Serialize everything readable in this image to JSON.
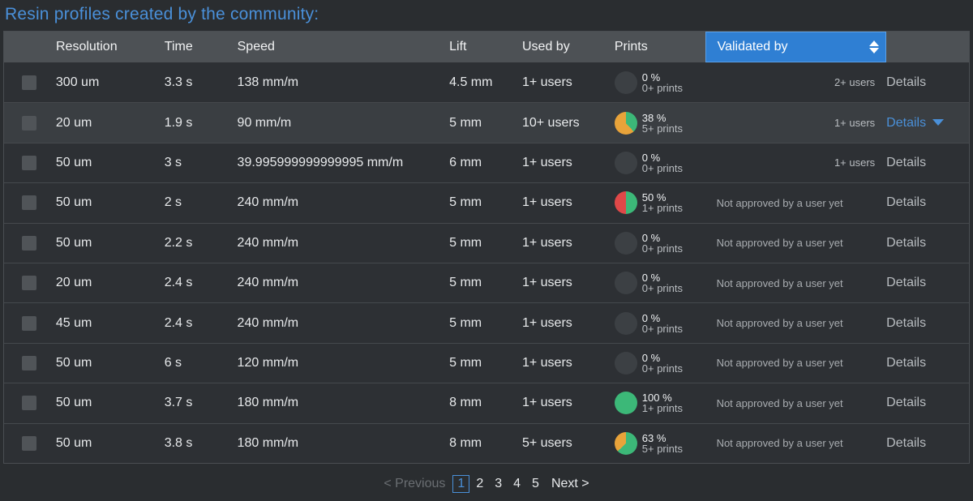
{
  "title": "Resin profiles created by the community:",
  "columns": {
    "resolution": "Resolution",
    "time": "Time",
    "speed": "Speed",
    "lift": "Lift",
    "used_by": "Used by",
    "prints": "Prints",
    "validated_by": "Validated by"
  },
  "rows": [
    {
      "resolution": "300 um",
      "time": "3.3 s",
      "speed": "138 mm/m",
      "lift": "4.5 mm",
      "used_by": "1+ users",
      "prints_pct": "0 %",
      "prints_count": "0+ prints",
      "pie_fraction": 0,
      "pie_color": "#e8a33a",
      "validated": "2+ users",
      "validated_type": "users",
      "details": "Details",
      "details_active": false
    },
    {
      "resolution": "20 um",
      "time": "1.9 s",
      "speed": "90 mm/m",
      "lift": "5 mm",
      "used_by": "10+ users",
      "prints_pct": "38 %",
      "prints_count": "5+ prints",
      "pie_fraction": 0.38,
      "pie_color": "#e8a33a",
      "validated": "1+ users",
      "validated_type": "users",
      "details": "Details",
      "details_active": true
    },
    {
      "resolution": "50 um",
      "time": "3 s",
      "speed": "39.995999999999995 mm/m",
      "lift": "6 mm",
      "used_by": "1+ users",
      "prints_pct": "0 %",
      "prints_count": "0+ prints",
      "pie_fraction": 0,
      "pie_color": "#e8a33a",
      "validated": "1+ users",
      "validated_type": "users",
      "details": "Details",
      "details_active": false
    },
    {
      "resolution": "50 um",
      "time": "2 s",
      "speed": "240 mm/m",
      "lift": "5 mm",
      "used_by": "1+ users",
      "prints_pct": "50 %",
      "prints_count": "1+ prints",
      "pie_fraction": 0.5,
      "pie_color": "#e04848",
      "validated": "Not approved by a user yet",
      "validated_type": "none",
      "details": "Details",
      "details_active": false
    },
    {
      "resolution": "50 um",
      "time": "2.2 s",
      "speed": "240 mm/m",
      "lift": "5 mm",
      "used_by": "1+ users",
      "prints_pct": "0 %",
      "prints_count": "0+ prints",
      "pie_fraction": 0,
      "pie_color": "#e8a33a",
      "validated": "Not approved by a user yet",
      "validated_type": "none",
      "details": "Details",
      "details_active": false
    },
    {
      "resolution": "20 um",
      "time": "2.4 s",
      "speed": "240 mm/m",
      "lift": "5 mm",
      "used_by": "1+ users",
      "prints_pct": "0 %",
      "prints_count": "0+ prints",
      "pie_fraction": 0,
      "pie_color": "#e8a33a",
      "validated": "Not approved by a user yet",
      "validated_type": "none",
      "details": "Details",
      "details_active": false
    },
    {
      "resolution": "45 um",
      "time": "2.4 s",
      "speed": "240 mm/m",
      "lift": "5 mm",
      "used_by": "1+ users",
      "prints_pct": "0 %",
      "prints_count": "0+ prints",
      "pie_fraction": 0,
      "pie_color": "#e8a33a",
      "validated": "Not approved by a user yet",
      "validated_type": "none",
      "details": "Details",
      "details_active": false
    },
    {
      "resolution": "50 um",
      "time": "6 s",
      "speed": "120 mm/m",
      "lift": "5 mm",
      "used_by": "1+ users",
      "prints_pct": "0 %",
      "prints_count": "0+ prints",
      "pie_fraction": 0,
      "pie_color": "#e8a33a",
      "validated": "Not approved by a user yet",
      "validated_type": "none",
      "details": "Details",
      "details_active": false
    },
    {
      "resolution": "50 um",
      "time": "3.7 s",
      "speed": "180 mm/m",
      "lift": "8 mm",
      "used_by": "1+ users",
      "prints_pct": "100 %",
      "prints_count": "1+ prints",
      "pie_fraction": 1,
      "pie_color": "#e8a33a",
      "validated": "Not approved by a user yet",
      "validated_type": "none",
      "details": "Details",
      "details_active": false
    },
    {
      "resolution": "50 um",
      "time": "3.8 s",
      "speed": "180 mm/m",
      "lift": "8 mm",
      "used_by": "5+ users",
      "prints_pct": "63 %",
      "prints_count": "5+ prints",
      "pie_fraction": 0.63,
      "pie_color": "#e8a33a",
      "validated": "Not approved by a user yet",
      "validated_type": "none",
      "details": "Details",
      "details_active": false
    }
  ],
  "colors": {
    "pie_success": "#3cb878",
    "pie_empty": "#3c4044",
    "accent": "#4a90d9"
  },
  "pagination": {
    "previous": "< Previous",
    "pages": [
      "1",
      "2",
      "3",
      "4",
      "5"
    ],
    "current": "1",
    "next": "Next >"
  }
}
